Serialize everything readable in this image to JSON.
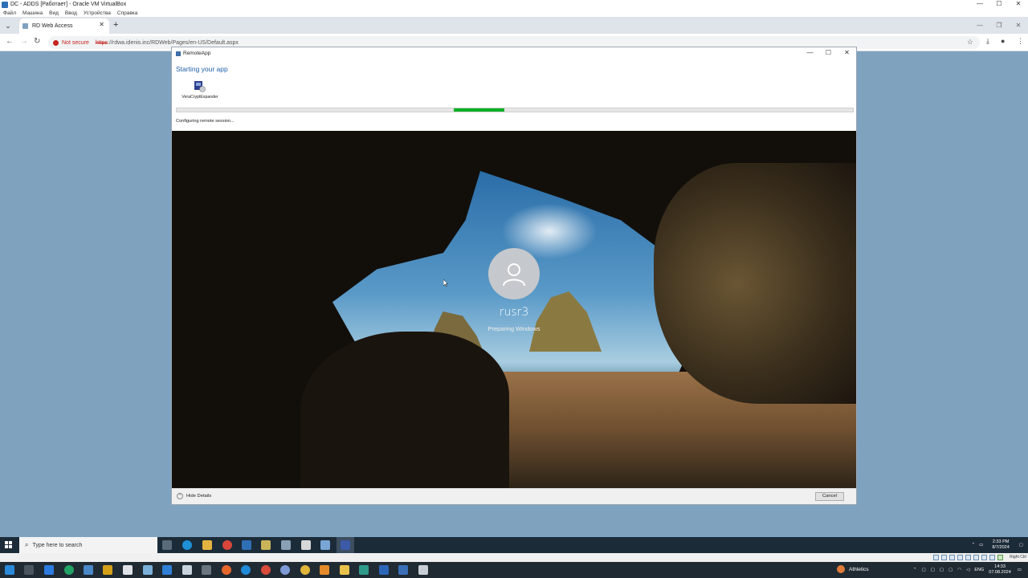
{
  "vbox": {
    "title": "DC - ADDS [Работает] - Oracle VM VirtualBox",
    "menu": [
      "Файл",
      "Машина",
      "Вид",
      "Ввод",
      "Устройства",
      "Справка"
    ],
    "host_key": "Right Ctrl"
  },
  "browser": {
    "tab_title": "RD Web Access",
    "not_secure": "Not secure",
    "url_scheme": "https",
    "url_rest": "://rdwa.idenis.inc/RDWeb/Pages/en-US/Default.aspx"
  },
  "remoteapp": {
    "window_title": "RemoteApp",
    "heading": "Starting your app",
    "app_name": "VeraCryptExpander",
    "progress": 0.075,
    "progress_start": 0.41,
    "status": "Configuring remote session...",
    "hide_details": "Hide Details",
    "cancel": "Cancel"
  },
  "lockscreen": {
    "username": "rusr3",
    "status": "Preparing Windows"
  },
  "guest_taskbar": {
    "search_placeholder": "Type here to search",
    "time": "2:33 PM",
    "date": "8/7/2024"
  },
  "host_taskbar": {
    "weather": "Athletics",
    "lang": "ENG",
    "time": "14:33",
    "date": "07.08.2024"
  },
  "colors": {
    "progress_fill": "#06b025",
    "heading_blue": "#1f5fa8",
    "desktop_bg": "#7fa2bf"
  }
}
